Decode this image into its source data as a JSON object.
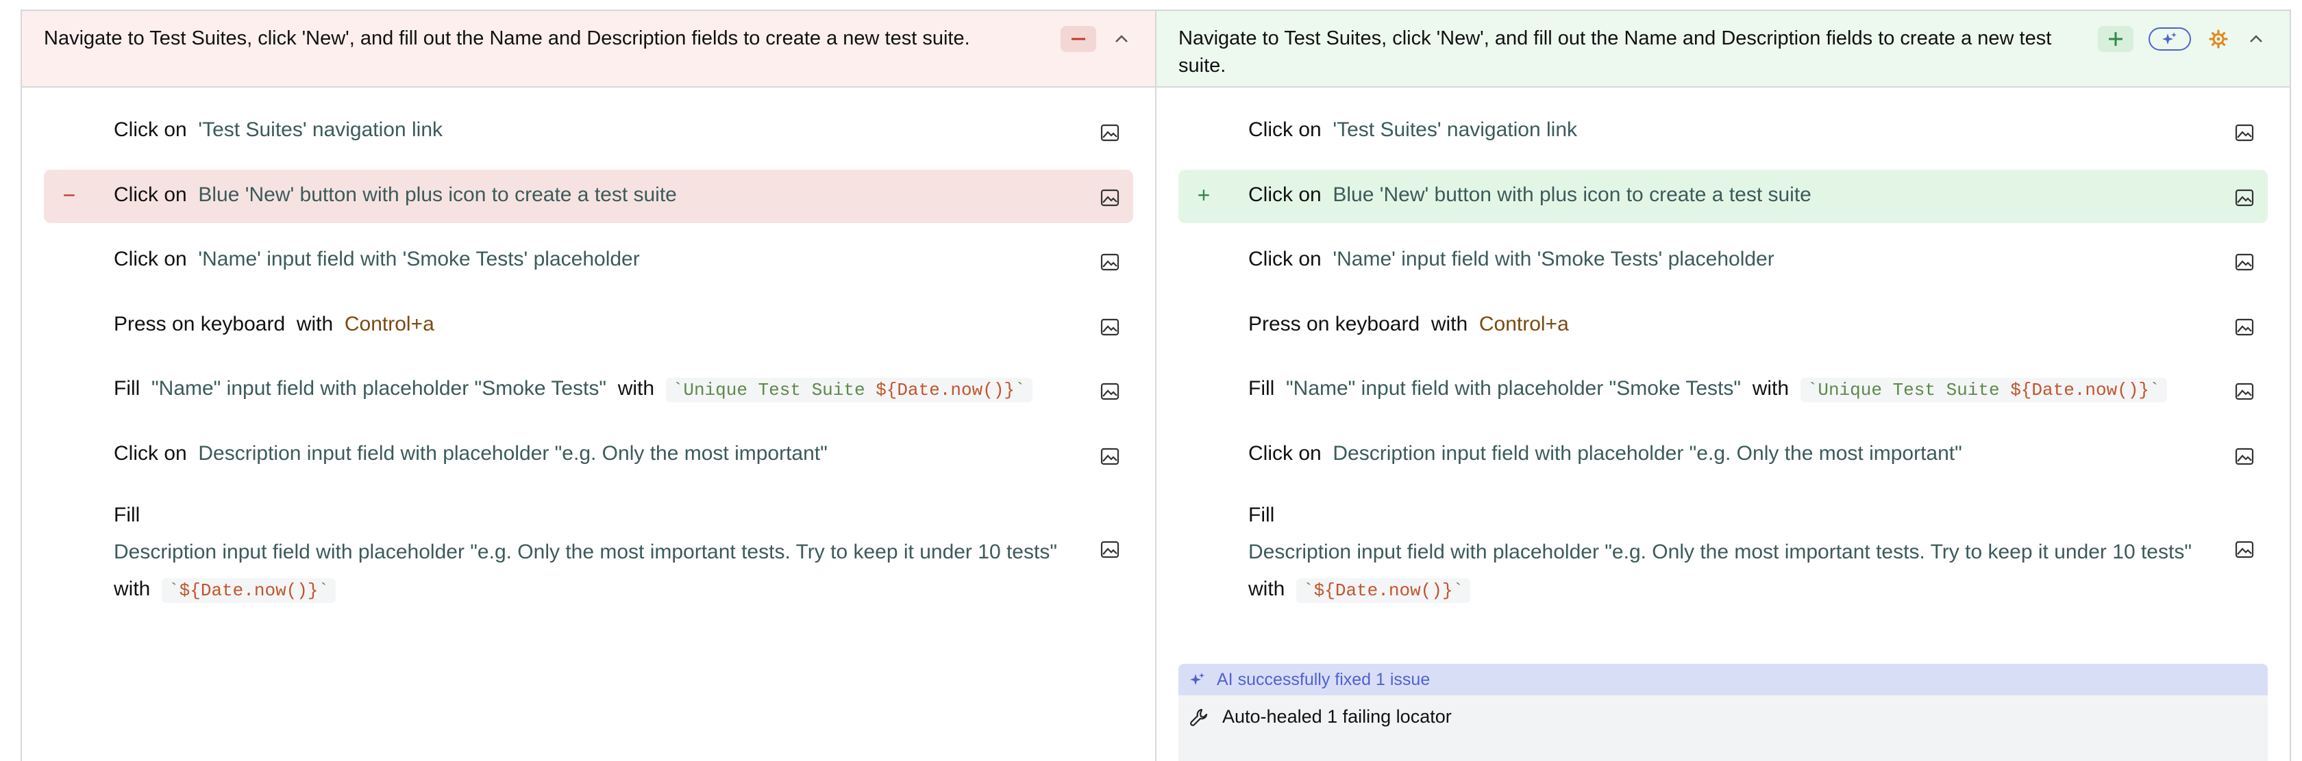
{
  "panes": [
    {
      "title": "Navigate to Test Suites, click 'New', and fill out the Name and Description fields to create a new test suite.",
      "steps": [
        {
          "action": "Click on",
          "target": "'Test Suites' navigation link"
        },
        {
          "marker": "−",
          "action": "Click on",
          "target": "Blue 'New' button with plus icon to create a test suite"
        },
        {
          "action": "Click on",
          "target": "'Name' input field with 'Smoke Tests' placeholder"
        },
        {
          "action": "Press on keyboard",
          "with": "with",
          "value": "Control+a"
        },
        {
          "action": "Fill",
          "target": "\"Name\" input field with placeholder \"Smoke Tests\"",
          "with": "with",
          "code_prefix": "`Unique Test Suite ",
          "code_expr": "${Date.now()}",
          "code_suffix": "`"
        },
        {
          "action": "Click on",
          "target": "Description input field with placeholder \"e.g. Only the most important\""
        },
        {
          "action": "Fill",
          "target": "Description input field with placeholder \"e.g. Only the most important tests. Try to keep it under 10 tests\"",
          "with": "with",
          "code_prefix": "`",
          "code_expr": "${Date.now()}",
          "code_suffix": "`"
        }
      ]
    },
    {
      "title": "Navigate to Test Suites, click 'New', and fill out the Name and Description fields to create a new test suite.",
      "steps": [
        {
          "action": "Click on",
          "target": "'Test Suites' navigation link"
        },
        {
          "marker": "+",
          "action": "Click on",
          "target": "Blue 'New' button with plus icon to create a test suite"
        },
        {
          "action": "Click on",
          "target": "'Name' input field with 'Smoke Tests' placeholder"
        },
        {
          "action": "Press on keyboard",
          "with": "with",
          "value": "Control+a"
        },
        {
          "action": "Fill",
          "target": "\"Name\" input field with placeholder \"Smoke Tests\"",
          "with": "with",
          "code_prefix": "`Unique Test Suite ",
          "code_expr": "${Date.now()}",
          "code_suffix": "`"
        },
        {
          "action": "Click on",
          "target": "Description input field with placeholder \"e.g. Only the most important\""
        },
        {
          "action": "Fill",
          "target": "Description input field with placeholder \"e.g. Only the most important tests. Try to keep it under 10 tests\"",
          "with": "with",
          "code_prefix": "`",
          "code_expr": "${Date.now()}",
          "code_suffix": "`"
        }
      ],
      "ai": {
        "banner": "AI successfully fixed 1 issue",
        "item": "Auto-healed 1 failing locator"
      }
    }
  ],
  "icons": {
    "step_image": "image-icon",
    "collapse": "chevron-up-icon",
    "remove": "minus-icon",
    "add": "plus-icon",
    "ai": "sparkles-icon",
    "settings": "gear-icon",
    "heal": "wrench-icon"
  },
  "colors": {
    "removed_bg": "#f6e3e1",
    "added_bg": "#e3f6e6",
    "ai_accent": "#4f63d2",
    "gear_accent": "#e08a1e"
  }
}
